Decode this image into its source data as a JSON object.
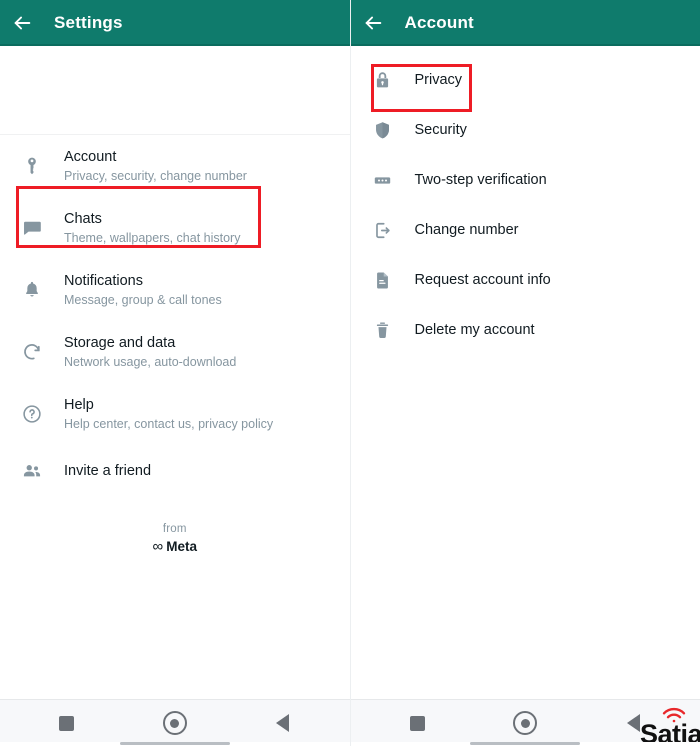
{
  "left_screen": {
    "appbar": {
      "back_icon": "arrow-left-icon",
      "title": "Settings",
      "background_color": "#0f7b6c"
    },
    "items": [
      {
        "icon": "key-icon",
        "title": "Account",
        "subtitle": "Privacy, security, change number",
        "highlighted": true
      },
      {
        "icon": "chat-icon",
        "title": "Chats",
        "subtitle": "Theme, wallpapers, chat history",
        "highlighted": false
      },
      {
        "icon": "bell-icon",
        "title": "Notifications",
        "subtitle": "Message, group & call tones",
        "highlighted": false
      },
      {
        "icon": "storage-arrows-icon",
        "title": "Storage and data",
        "subtitle": "Network usage, auto-download",
        "highlighted": false
      },
      {
        "icon": "help-question-icon",
        "title": "Help",
        "subtitle": "Help center, contact us, privacy policy",
        "highlighted": false
      },
      {
        "icon": "people-icon",
        "title": "Invite a friend",
        "subtitle": "",
        "highlighted": false
      }
    ],
    "brand": {
      "from_label": "from",
      "company": "Meta",
      "company_glyph": "∞"
    },
    "navbar": {
      "recents_icon": "square-icon",
      "home_icon": "circle-icon",
      "back_icon": "triangle-back-icon"
    }
  },
  "right_screen": {
    "appbar": {
      "back_icon": "arrow-left-icon",
      "title": "Account",
      "background_color": "#0f7b6c"
    },
    "items": [
      {
        "icon": "lock-icon",
        "title": "Privacy",
        "highlighted": true
      },
      {
        "icon": "shield-icon",
        "title": "Security",
        "highlighted": false
      },
      {
        "icon": "two-step-dots-icon",
        "title": "Two-step verification",
        "highlighted": false
      },
      {
        "icon": "change-number-icon",
        "title": "Change number",
        "highlighted": false
      },
      {
        "icon": "document-icon",
        "title": "Request account info",
        "highlighted": false
      },
      {
        "icon": "trash-icon",
        "title": "Delete my account",
        "highlighted": false
      }
    ],
    "navbar": {
      "recents_icon": "square-icon",
      "home_icon": "circle-icon",
      "back_icon": "triangle-back-icon"
    },
    "watermark": {
      "text": "Satia",
      "accent_color": "#e8282b"
    }
  },
  "highlight_color": "#ee1c25"
}
